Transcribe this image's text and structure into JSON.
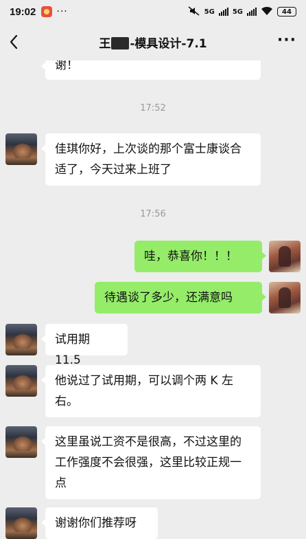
{
  "status_bar": {
    "time": "19:02",
    "dots": "···",
    "net1": "5G",
    "net2": "5G",
    "battery": "44"
  },
  "header": {
    "title_prefix": "王",
    "title_suffix": "-模具设计-7.1"
  },
  "messages": [
    {
      "side": "in",
      "text": "谢！"
    },
    {
      "type": "time",
      "text": "17:52"
    },
    {
      "side": "in",
      "text": "佳琪你好，上次谈的那个富士康谈合适了，今天过来上班了"
    },
    {
      "type": "time",
      "text": "17:56"
    },
    {
      "side": "out",
      "text": "哇，恭喜你！！！"
    },
    {
      "side": "out",
      "text": "待遇谈了多少，还满意吗"
    },
    {
      "side": "in",
      "text": "试用期 11.5"
    },
    {
      "side": "in",
      "text": "他说过了试用期，可以调个两 K 左右。"
    },
    {
      "side": "in",
      "text": "这里虽说工资不是很高，不过这里的工作强度不会很强，这里比较正规一点"
    },
    {
      "side": "in",
      "text": "谢谢你们推荐呀"
    }
  ]
}
